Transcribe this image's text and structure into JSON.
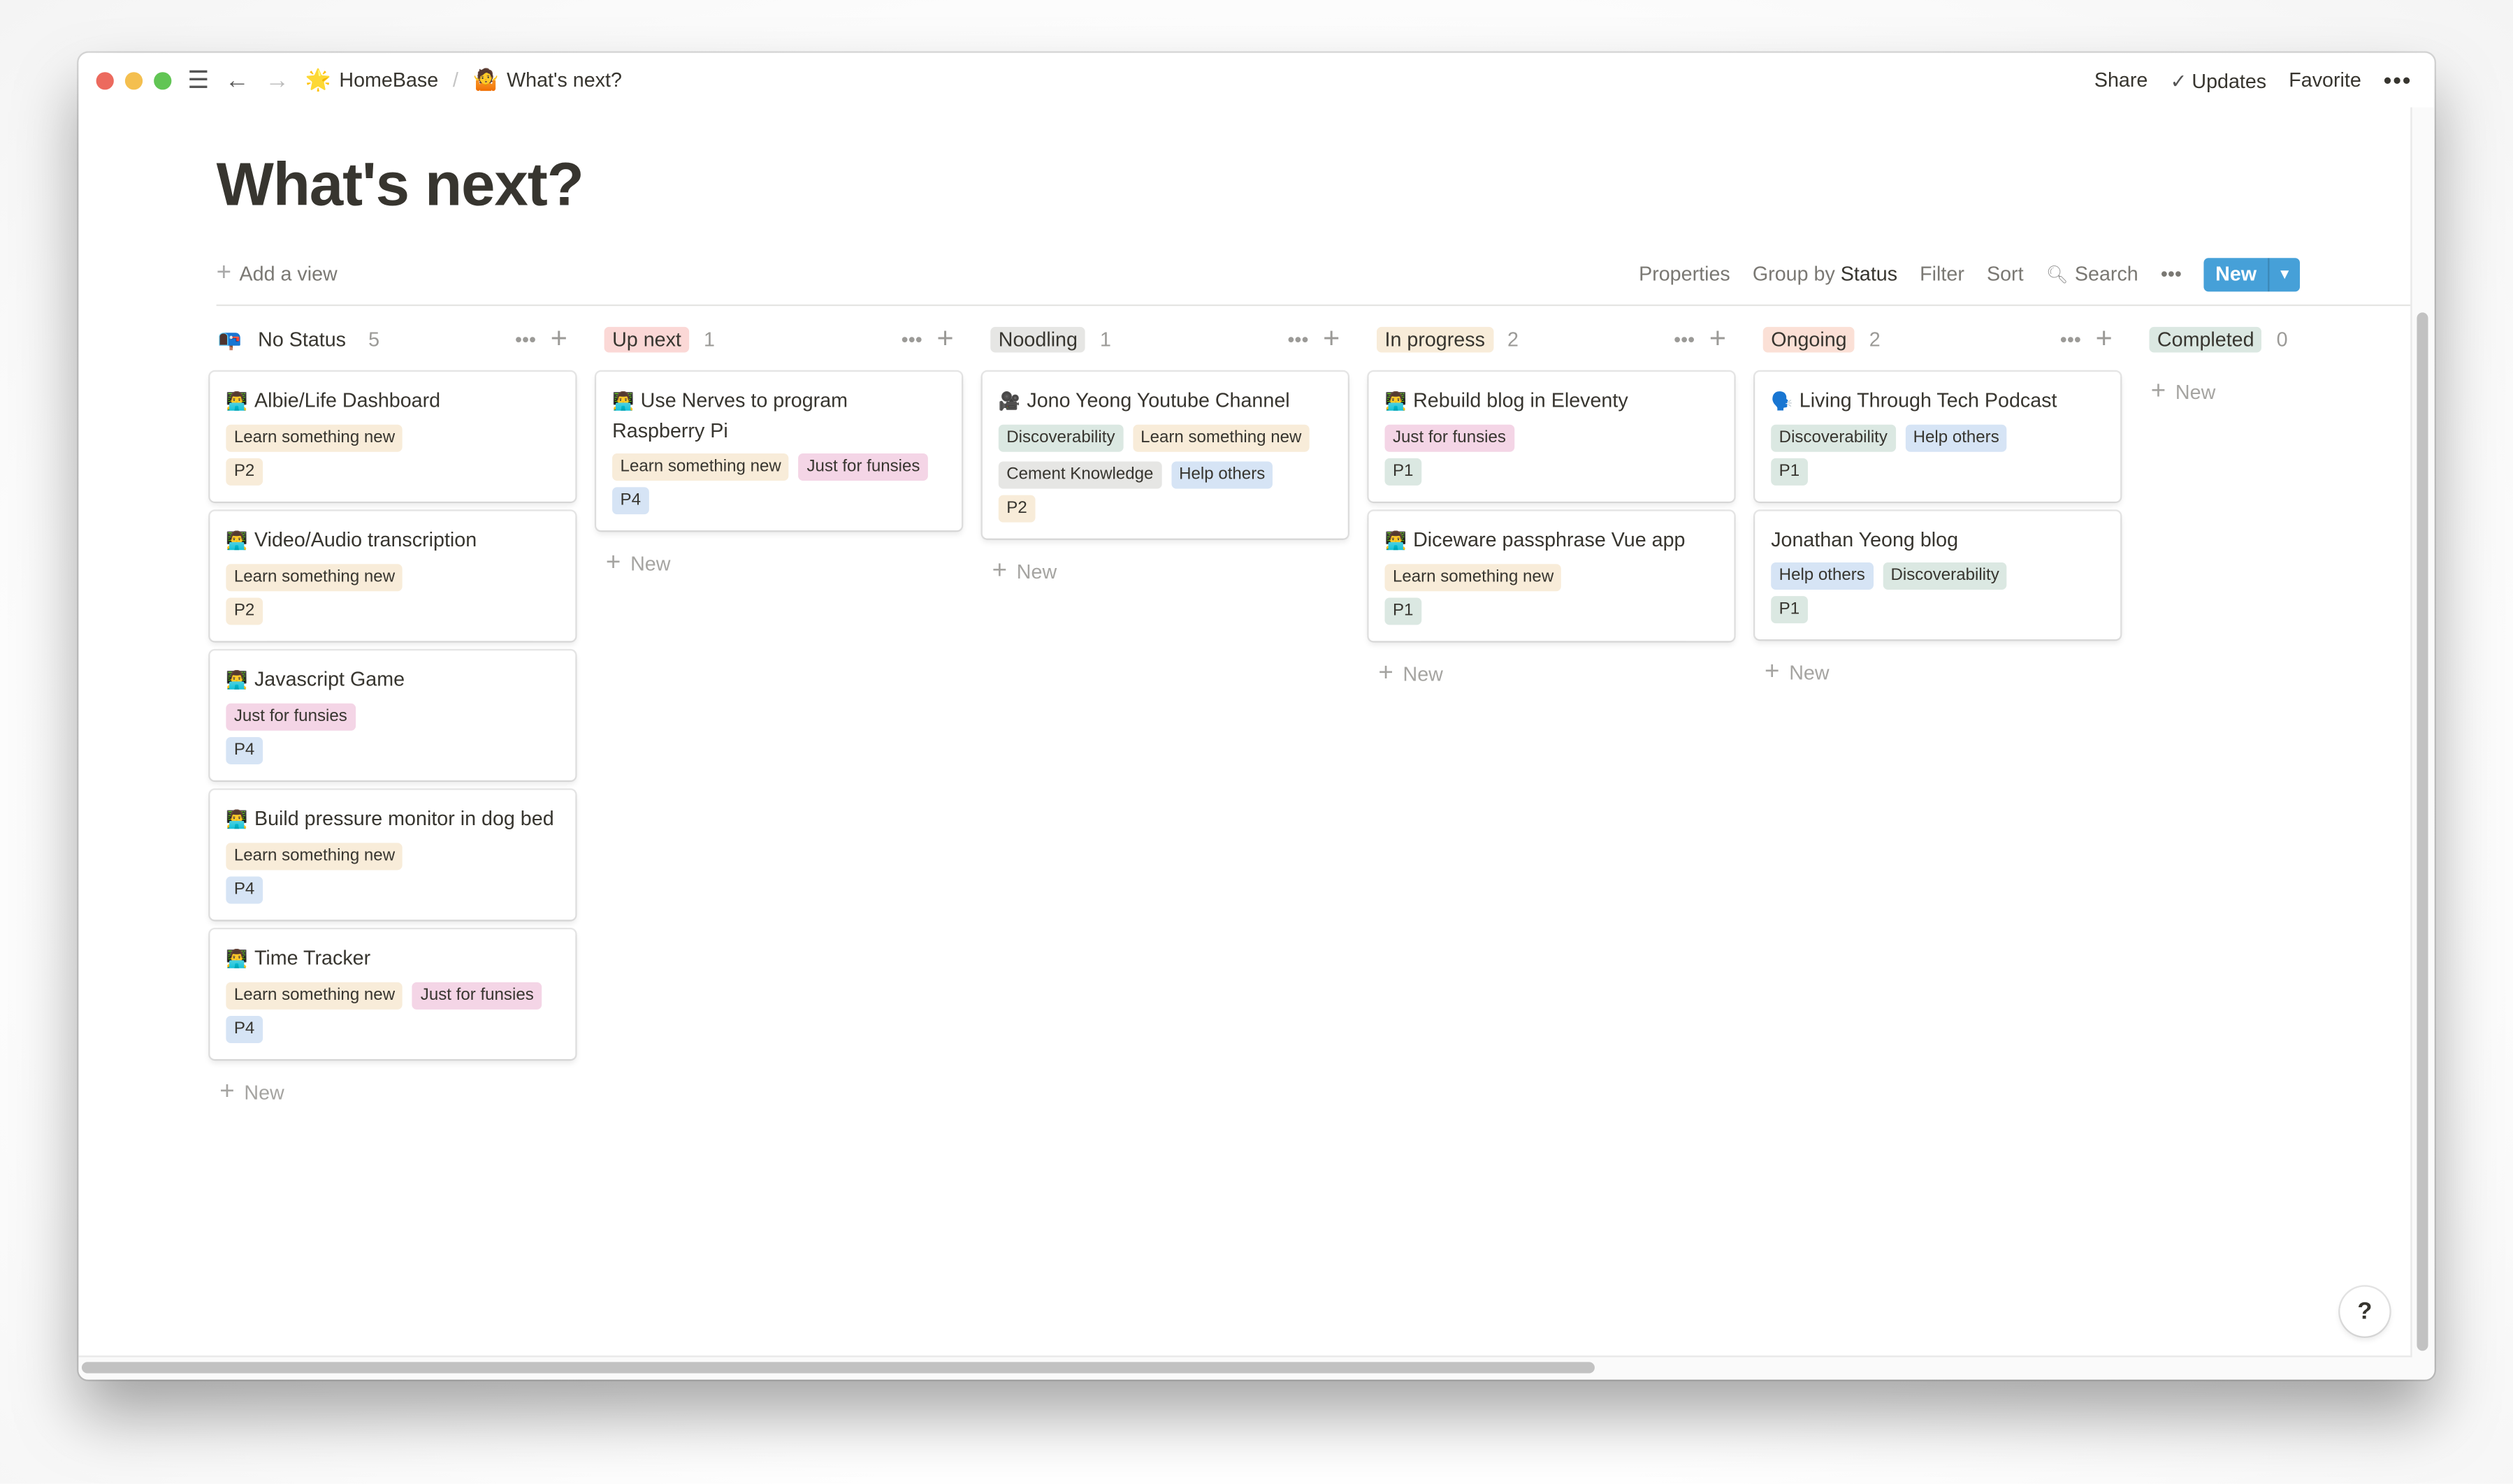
{
  "titlebar": {
    "menu_icon": "hamburger-icon",
    "back_icon": "arrow-left-icon",
    "forward_icon": "arrow-right-icon",
    "breadcrumb": [
      {
        "emoji": "🌟",
        "label": "HomeBase"
      },
      {
        "emoji": "🤷",
        "label": "What's next?"
      }
    ],
    "separator": "/",
    "share": "Share",
    "updates": "Updates",
    "favorite": "Favorite",
    "more": "•••"
  },
  "page": {
    "title": "What's next?"
  },
  "viewbar": {
    "add_view": "Add a view",
    "properties": "Properties",
    "group_by_prefix": "Group by",
    "group_by_value": "Status",
    "filter": "Filter",
    "sort": "Sort",
    "search": "Search",
    "more": "•••",
    "new": "New",
    "new_caret": "⌄"
  },
  "colors": {
    "accent": "#46a0d8",
    "tag_learn": "#f8ecd9",
    "tag_funsies": "#f4d5e6",
    "tag_discover": "#dbe8e2",
    "tag_cement": "#e6e6e4",
    "tag_help": "#d6e4f5",
    "p1": "#dbe8e2",
    "p2": "#f8ecd9",
    "p4": "#d6e4f5",
    "status_upnext": "#fbd8d6",
    "status_noodling": "#e6e6e4",
    "status_inprogress": "#f8ecd9",
    "status_ongoing": "#fbe0d6",
    "status_completed": "#dbe8e2"
  },
  "columns": [
    {
      "label": "No Status",
      "count": "5",
      "icon": "📭",
      "pill_color": "",
      "new_label": "New",
      "cards": [
        {
          "emoji": "👨‍💻",
          "title": "Albie/Life Dashboard",
          "tags": [
            {
              "label": "Learn something new",
              "color": "#f8ecd9"
            }
          ],
          "priority": {
            "label": "P2",
            "color": "#f8ecd9"
          }
        },
        {
          "emoji": "👨‍💻",
          "title": "Video/Audio transcription",
          "tags": [
            {
              "label": "Learn something new",
              "color": "#f8ecd9"
            }
          ],
          "priority": {
            "label": "P2",
            "color": "#f8ecd9"
          }
        },
        {
          "emoji": "👨‍💻",
          "title": "Javascript Game",
          "tags": [
            {
              "label": "Just for funsies",
              "color": "#f4d5e6"
            }
          ],
          "priority": {
            "label": "P4",
            "color": "#d6e4f5"
          }
        },
        {
          "emoji": "👨‍💻",
          "title": "Build pressure monitor in dog bed",
          "tags": [
            {
              "label": "Learn something new",
              "color": "#f8ecd9"
            }
          ],
          "priority": {
            "label": "P4",
            "color": "#d6e4f5"
          }
        },
        {
          "emoji": "👨‍💻",
          "title": "Time Tracker",
          "tags": [
            {
              "label": "Learn something new",
              "color": "#f8ecd9"
            },
            {
              "label": "Just for funsies",
              "color": "#f4d5e6"
            }
          ],
          "priority": {
            "label": "P4",
            "color": "#d6e4f5"
          }
        }
      ]
    },
    {
      "label": "Up next",
      "count": "1",
      "icon": "",
      "pill_color": "#fbd8d6",
      "new_label": "New",
      "cards": [
        {
          "emoji": "👨‍💻",
          "title": "Use Nerves to program Raspberry Pi",
          "tags": [
            {
              "label": "Learn something new",
              "color": "#f8ecd9"
            },
            {
              "label": "Just for funsies",
              "color": "#f4d5e6"
            }
          ],
          "priority": {
            "label": "P4",
            "color": "#d6e4f5"
          }
        }
      ]
    },
    {
      "label": "Noodling",
      "count": "1",
      "icon": "",
      "pill_color": "#e6e6e4",
      "new_label": "New",
      "cards": [
        {
          "emoji": "🎥",
          "title": "Jono Yeong Youtube Channel",
          "tags": [
            {
              "label": "Discoverability",
              "color": "#dbe8e2"
            },
            {
              "label": "Learn something new",
              "color": "#f8ecd9"
            },
            {
              "label": "Cement Knowledge",
              "color": "#e6e6e4"
            },
            {
              "label": "Help others",
              "color": "#d6e4f5"
            }
          ],
          "priority": {
            "label": "P2",
            "color": "#f8ecd9"
          }
        }
      ]
    },
    {
      "label": "In progress",
      "count": "2",
      "icon": "",
      "pill_color": "#f8ecd9",
      "new_label": "New",
      "cards": [
        {
          "emoji": "👨‍💻",
          "title": "Rebuild blog in Eleventy",
          "tags": [
            {
              "label": "Just for funsies",
              "color": "#f4d5e6"
            }
          ],
          "priority": {
            "label": "P1",
            "color": "#dbe8e2"
          }
        },
        {
          "emoji": "👨‍💻",
          "title": "Diceware passphrase Vue app",
          "tags": [
            {
              "label": "Learn something new",
              "color": "#f8ecd9"
            }
          ],
          "priority": {
            "label": "P1",
            "color": "#dbe8e2"
          }
        }
      ]
    },
    {
      "label": "Ongoing",
      "count": "2",
      "icon": "",
      "pill_color": "#fbe0d6",
      "new_label": "New",
      "cards": [
        {
          "emoji": "🗣️",
          "title": "Living Through Tech Podcast",
          "tags": [
            {
              "label": "Discoverability",
              "color": "#dbe8e2"
            },
            {
              "label": "Help others",
              "color": "#d6e4f5"
            }
          ],
          "priority": {
            "label": "P1",
            "color": "#dbe8e2"
          }
        },
        {
          "emoji": "",
          "title": "Jonathan Yeong blog",
          "tags": [
            {
              "label": "Help others",
              "color": "#d6e4f5"
            },
            {
              "label": "Discoverability",
              "color": "#dbe8e2"
            }
          ],
          "priority": {
            "label": "P1",
            "color": "#dbe8e2"
          }
        }
      ]
    },
    {
      "label": "Completed",
      "count": "0",
      "icon": "",
      "pill_color": "#dbe8e2",
      "new_label": "New",
      "cards": []
    }
  ],
  "help": "?"
}
